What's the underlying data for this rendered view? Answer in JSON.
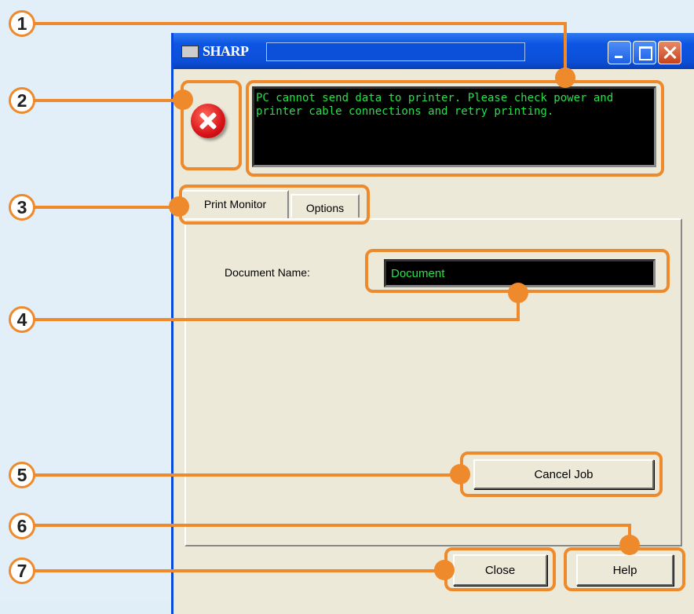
{
  "window": {
    "title": "SHARP",
    "title_field": ""
  },
  "message": {
    "text": "PC cannot send data to printer. Please check power and printer cable connections and retry printing."
  },
  "tabs": [
    {
      "label": "Print Monitor",
      "selected": true
    },
    {
      "label": "Options",
      "selected": false
    }
  ],
  "document": {
    "label": "Document Name:",
    "value": "Document"
  },
  "buttons": {
    "cancel_job": "Cancel Job",
    "close": "Close",
    "help": "Help"
  },
  "callouts": [
    "1",
    "2",
    "3",
    "4",
    "5",
    "6",
    "7"
  ],
  "colors": {
    "accent": "#ee8a2b",
    "text_green": "#27e04a",
    "titlebar": "#0b4fd6",
    "window_bg": "#ece9d8",
    "page_bg": "#e2eff9"
  },
  "icons": {
    "error": "error-x-icon",
    "app": "printer-icon"
  }
}
